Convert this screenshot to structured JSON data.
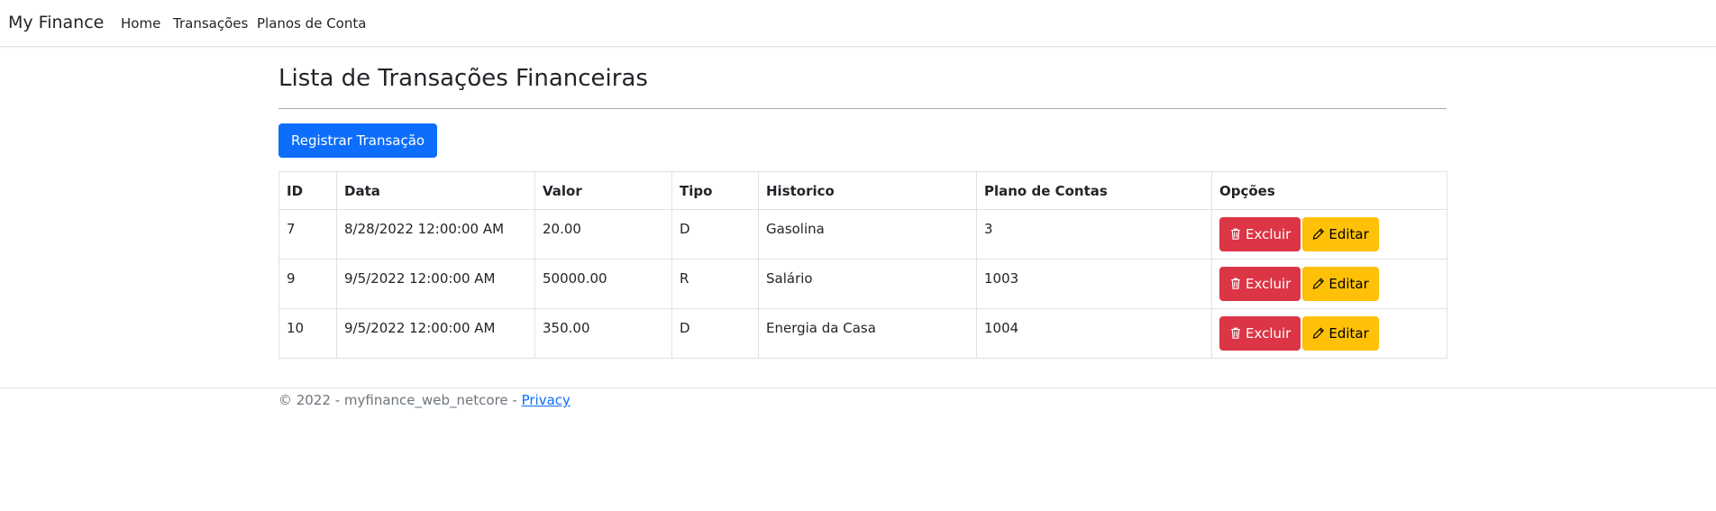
{
  "navbar": {
    "brand": "My Finance",
    "links": [
      "Home",
      "Transações",
      "Planos de Conta"
    ]
  },
  "page": {
    "title": "Lista de Transações Financeiras",
    "register_button": "Registrar Transação"
  },
  "table": {
    "headers": [
      "ID",
      "Data",
      "Valor",
      "Tipo",
      "Historico",
      "Plano de Contas",
      "Opções"
    ],
    "rows": [
      {
        "id": "7",
        "data": "8/28/2022 12:00:00 AM",
        "valor": "20.00",
        "tipo": "D",
        "historico": "Gasolina",
        "plano": "3"
      },
      {
        "id": "9",
        "data": "9/5/2022 12:00:00 AM",
        "valor": "50000.00",
        "tipo": "R",
        "historico": "Salário",
        "plano": "1003"
      },
      {
        "id": "10",
        "data": "9/5/2022 12:00:00 AM",
        "valor": "350.00",
        "tipo": "D",
        "historico": "Energia da Casa",
        "plano": "1004"
      }
    ],
    "delete_label": "Excluir",
    "edit_label": "Editar",
    "delete_icon": "trash-icon",
    "edit_icon": "pencil-icon"
  },
  "footer": {
    "text": "© 2022 - myfinance_web_netcore - ",
    "privacy_link": "Privacy"
  },
  "colors": {
    "primary": "#0d6efd",
    "danger": "#dc3545",
    "warning": "#ffc107",
    "muted": "#6c757d"
  }
}
